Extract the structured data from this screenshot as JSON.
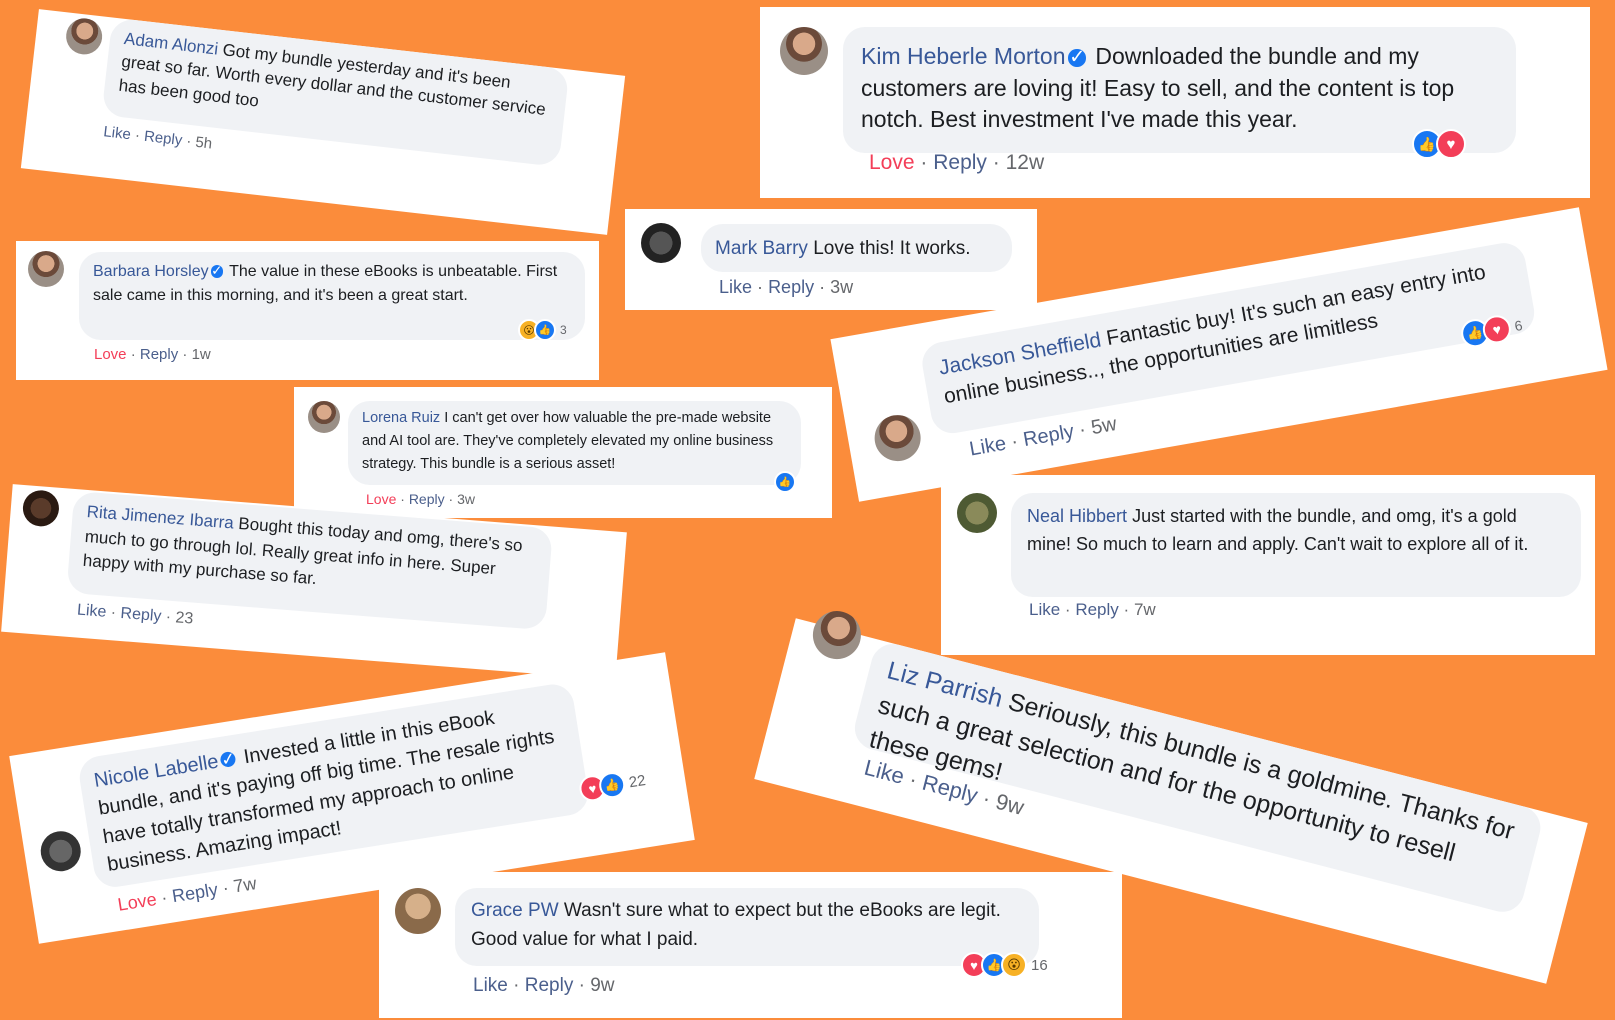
{
  "comments": {
    "adam": {
      "name": "Adam Alonzi",
      "text": "Got my bundle yesterday and it's been great so far. Worth every dollar and the customer service has been good too",
      "a1": "Like",
      "a2": "Reply",
      "time": "5h"
    },
    "kim": {
      "name": "Kim Heberle Morton",
      "text": "Downloaded the bundle and my customers are loving it! Easy to sell, and the content is top notch. Best investment I've made this year.",
      "a1": "Love",
      "a2": "Reply",
      "time": "12w"
    },
    "barbara": {
      "name": "Barbara Horsley",
      "text": "The value in these eBooks is unbeatable. First sale came in this morning, and it's been a great start.",
      "a1": "Love",
      "a2": "Reply",
      "time": "1w",
      "count": "3"
    },
    "mark": {
      "name": "Mark Barry",
      "text": "Love this! It works.",
      "a1": "Like",
      "a2": "Reply",
      "time": "3w"
    },
    "jackson": {
      "name": "Jackson Sheffield",
      "text": "Fantastic buy! It's such an easy entry into online business.., the opportunities are limitless",
      "a1": "Like",
      "a2": "Reply",
      "time": "5w",
      "count": "6"
    },
    "lorena": {
      "name": "Lorena Ruiz",
      "text": "I can't get over how valuable the pre-made website and AI tool are. They've completely elevated my online business strategy. This bundle is a serious asset!",
      "a1": "Love",
      "a2": "Reply",
      "time": "3w"
    },
    "rita": {
      "name": "Rita Jimenez Ibarra",
      "text": "Bought this today and omg, there's so much to go through lol. Really great info in here. Super happy with my purchase so far.",
      "a1": "Like",
      "a2": "Reply",
      "time": "23"
    },
    "neal": {
      "name": "Neal Hibbert",
      "text": "Just started with the bundle, and omg, it's a gold mine! So much to learn and apply. Can't wait to explore all of it.",
      "a1": "Like",
      "a2": "Reply",
      "time": "7w"
    },
    "nicole": {
      "name": "Nicole Labelle",
      "text": "Invested a little in this eBook bundle, and it's paying off big time. The resale rights have totally transformed my approach to online business. Amazing impact!",
      "a1": "Love",
      "a2": "Reply",
      "time": "7w",
      "count": "22"
    },
    "liz": {
      "name": "Liz Parrish",
      "text": "Seriously, this bundle is a goldmine. Thanks for such a great selection and for the opportunity to resell these gems!",
      "a1": "Like",
      "a2": "Reply",
      "time": "9w"
    },
    "grace": {
      "name": "Grace PW",
      "text": "Wasn't sure what to expect but the eBooks are legit. Good value for what I paid.",
      "a1": "Like",
      "a2": "Reply",
      "time": "9w",
      "count": "16"
    }
  },
  "separator": "·",
  "icons": {
    "like": "like-reaction-icon",
    "love": "love-reaction-icon",
    "wow": "wow-reaction-icon",
    "verified": "verified-badge-icon"
  },
  "colors": {
    "background": "#fb8c3b",
    "name": "#385898",
    "love": "#f33e58",
    "like": "#1877f2",
    "bubble": "#f0f2f5"
  }
}
